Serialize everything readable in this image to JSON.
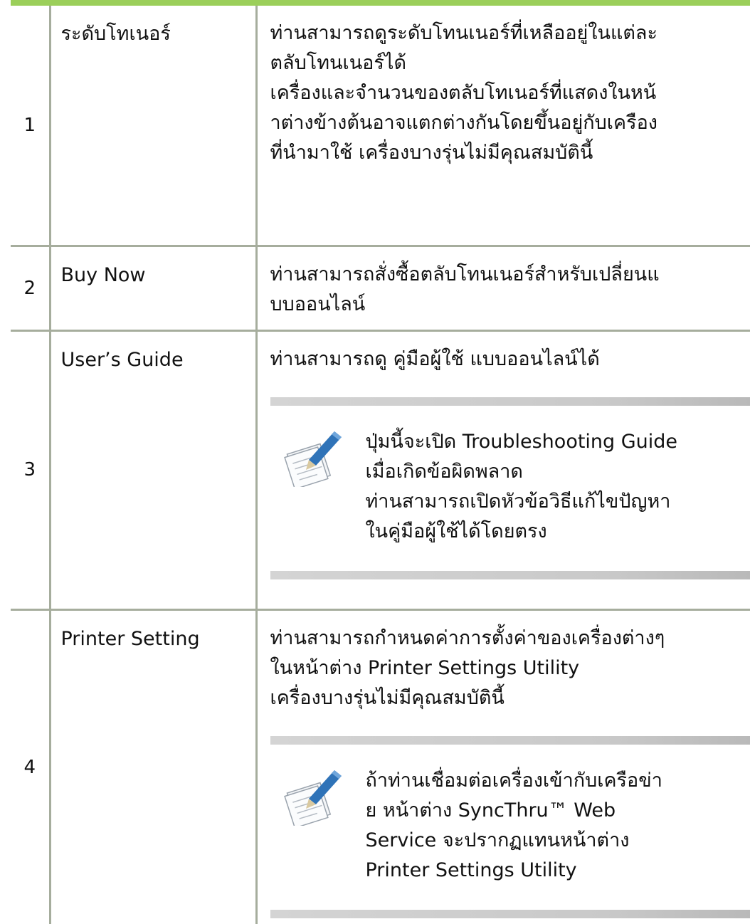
{
  "rows": [
    {
      "number": "1",
      "name": "ระดับโทเนอร์",
      "description": [
        "ท่านสามารถดูระดับโทนเนอร์ที่เหลืออยู่ในแต่ละ",
        "ตลับโทนเนอร์ได้",
        "เครื่องและจำนวนของตลับโทเนอร์ที่แสดงในหน้",
        "าต่างข้างต้นอาจแตกต่างกันโดยขึ้นอยู่กับเครือง",
        "ที่นำมาใช้ เครื่องบางรุ่นไม่มีคุณสมบัตินี้"
      ]
    },
    {
      "number": "2",
      "name": "Buy Now",
      "description": [
        "ท่านสามารถสั่งซื้อตลับโทนเนอร์สำหรับเปลี่ยนแ",
        "บบออนไลน์"
      ]
    },
    {
      "number": "3",
      "name": "User’s Guide",
      "description": [
        "ท่านสามารถดู คู่มือผู้ใช้ แบบออนไลน์ได้"
      ],
      "note": {
        "icon": "note-pencil-icon",
        "lines": [
          "ปุ่มนี้จะเปิด Troubleshooting Guide",
          "เมื่อเกิดข้อผิดพลาด",
          "ท่านสามารถเปิดหัวข้อวิธีแก้ไขปัญหา",
          "ในคู่มือผู้ใช้ได้โดยตรง"
        ]
      }
    },
    {
      "number": "4",
      "name": "Printer Setting",
      "description": [
        "ท่านสามารถกำหนดค่าการตั้งค่าของเครื่องต่างๆ",
        "ในหน้าต่าง Printer Settings Utility",
        "เครื่องบางรุ่นไม่มีคุณสมบัตินี้"
      ],
      "note": {
        "icon": "note-pencil-icon",
        "lines": [
          "ถ้าท่านเชื่อมต่อเครื่องเข้ากับเครือข่า",
          "ย หน้าต่าง SyncThru™ Web",
          "Service จะปรากฏแทนหน้าต่าง",
          "Printer Settings Utility"
        ]
      }
    }
  ],
  "colors": {
    "accent_bar": "#9bcf5a",
    "rule": "#a6ad9d",
    "note_band": "#c9c9c9",
    "icon_pen": "#2f73b8"
  }
}
